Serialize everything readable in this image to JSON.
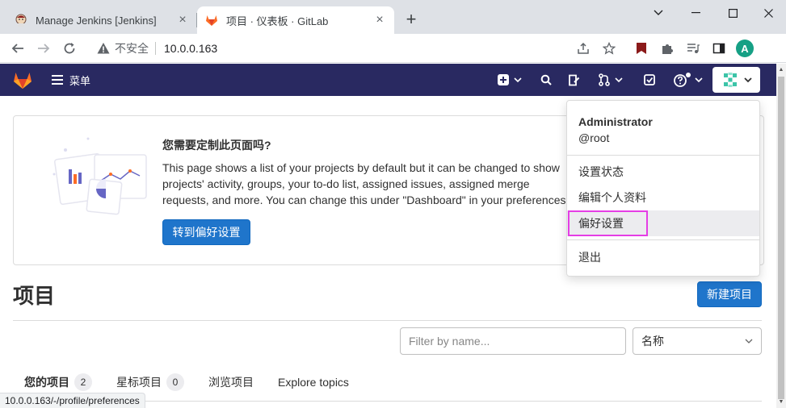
{
  "browser": {
    "tabs": [
      {
        "title": "Manage Jenkins [Jenkins]",
        "icon": "jenkins-icon",
        "active": false
      },
      {
        "title": "项目 · 仪表板 · GitLab",
        "icon": "gitlab-icon",
        "active": true
      }
    ],
    "security_label": "不安全",
    "url": "10.0.0.163",
    "profile_initial": "A",
    "status_url": "10.0.0.163/-/profile/preferences"
  },
  "header": {
    "menu_label": "菜单",
    "colors": {
      "background": "#292961",
      "accent": "#fc6d26"
    }
  },
  "promo": {
    "title": "您需要定制此页面吗?",
    "body": "This page shows a list of your projects by default but it can be changed to show projects' activity, groups, your to-do list, assigned issues, assigned merge requests, and more. You can change this under \"Dashboard\" in your preferences",
    "button": "转到偏好设置"
  },
  "main": {
    "title": "项目",
    "new_button": "新建项目",
    "filter_placeholder": "Filter by name...",
    "sort_value": "名称",
    "tabs": [
      {
        "label": "您的项目",
        "count": "2"
      },
      {
        "label": "星标项目",
        "count": "0"
      },
      {
        "label": "浏览项目"
      },
      {
        "label": "Explore topics"
      }
    ]
  },
  "user_menu": {
    "name": "Administrator",
    "username": "@root",
    "items": [
      "设置状态",
      "编辑个人资料",
      "偏好设置"
    ],
    "sign_out": "退出",
    "highlighted_item": "偏好设置",
    "highlight_color": "#e53ee5"
  }
}
